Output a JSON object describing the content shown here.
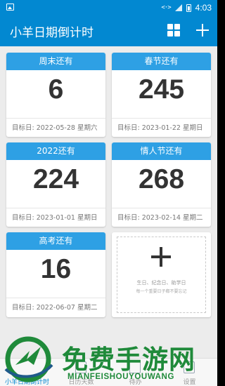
{
  "status_bar": {
    "signal_code": "<·>",
    "time": "4:03"
  },
  "app_bar": {
    "title": "小羊日期倒计时",
    "icons": [
      "grid-view-icon",
      "plus-icon"
    ]
  },
  "cards": [
    {
      "label": "周末还有",
      "days": "6",
      "target": "目标日: 2022-05-28 星期六"
    },
    {
      "label": "春节还有",
      "days": "245",
      "target": "目标日: 2023-01-22 星期日"
    },
    {
      "label": "2022还有",
      "days": "224",
      "target": "目标日: 2023-01-01 星期日"
    },
    {
      "label": "情人节还有",
      "days": "268",
      "target": "目标日: 2023-02-14 星期二"
    },
    {
      "label": "高考还有",
      "days": "16",
      "target": "目标日: 2022-06-07 星期二"
    }
  ],
  "add_card": {
    "line1": "生日、纪念日、助学日",
    "line2": "每一个重要日子都不要忘记"
  },
  "bottom_nav": [
    {
      "label": "小羊日期倒计时",
      "active": true
    },
    {
      "label": "日历天数",
      "active": false
    },
    {
      "label": "待办",
      "active": false
    },
    {
      "label": "设置",
      "active": false
    }
  ],
  "watermark": {
    "text": "免费手游网",
    "subtext": "MIANFEISHOUYOUWANG"
  },
  "colors": {
    "primary": "#0288d1",
    "card_header": "#2ea0e4",
    "watermark_green": "#1f8a3a"
  }
}
